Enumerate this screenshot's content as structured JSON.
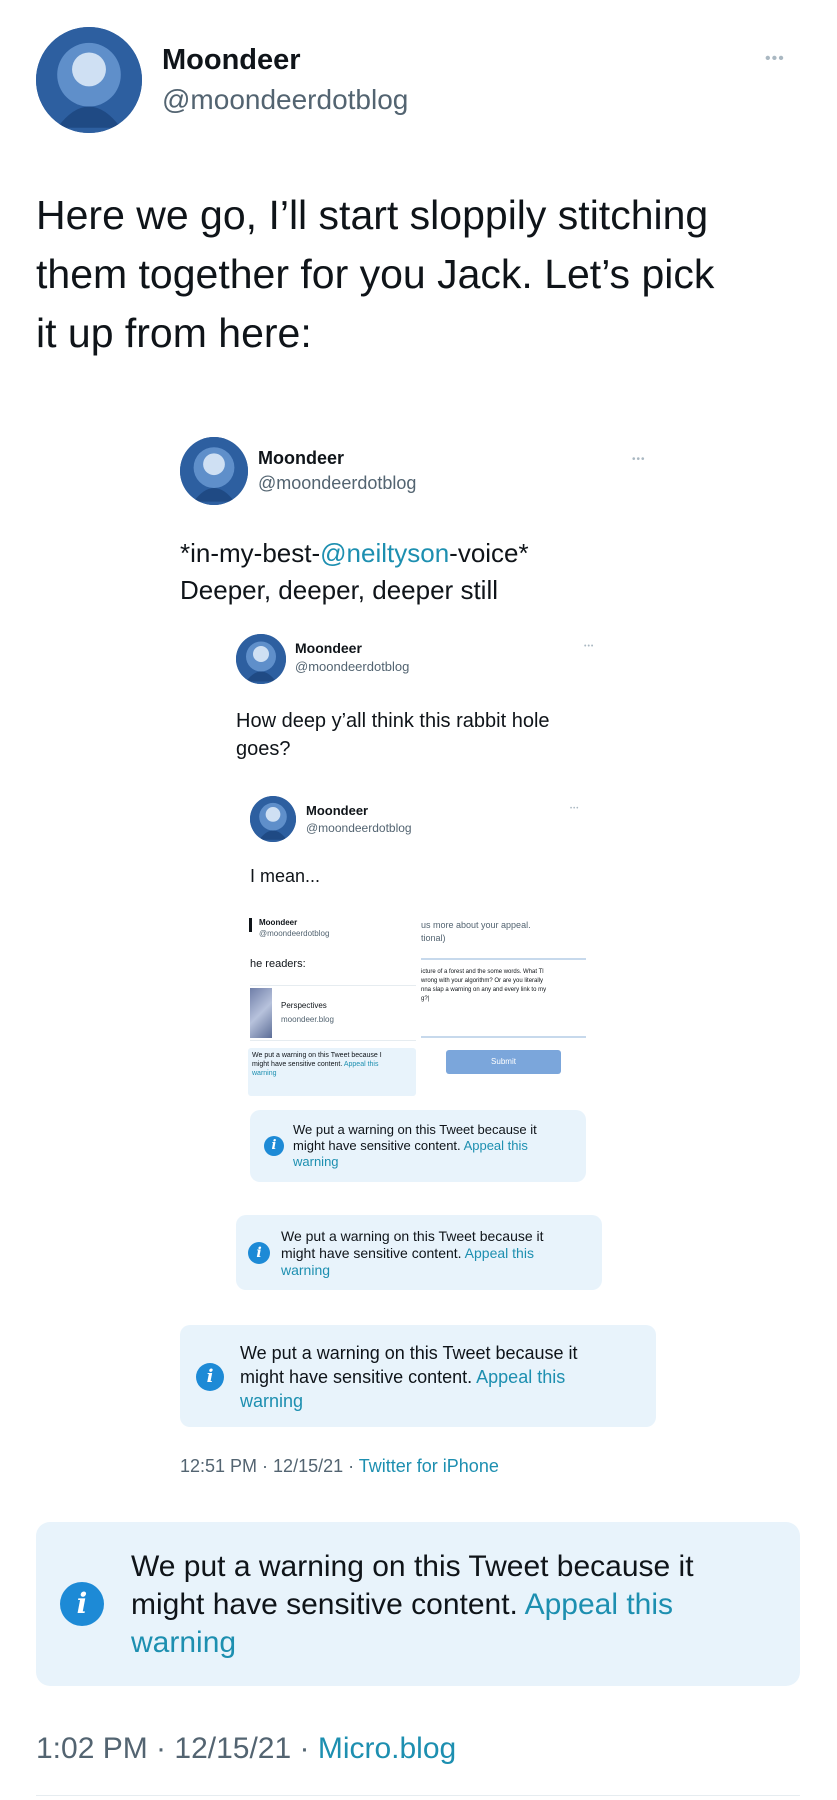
{
  "colors": {
    "accent": "#1d8fb0",
    "warning_bg": "#e8f3fb",
    "info_icon": "#1d8ad6"
  },
  "tweet": {
    "author_name": "Moondeer",
    "handle": "@moondeerdotblog",
    "more": "•••",
    "text_line1": "Here we go, I’ll start sloppily stitching",
    "text_line2": "them together for you Jack. Let’s pick",
    "text_line3": "it up from here:",
    "warning": {
      "line1": "We put a warning on this Tweet because it",
      "line2_text": "might have sensitive content.",
      "line2_link": "Appeal this",
      "line3_link": "warning"
    },
    "timestamp": "1:02 PM · 12/15/21 · ",
    "source": "Micro.blog"
  },
  "nested1": {
    "author_name": "Moondeer",
    "handle": "@moondeerdotblog",
    "more": "•••",
    "text_prefix": "*in-my-best-",
    "mention": "@neiltyson",
    "text_suffix": "-voice*",
    "text_line2": "Deeper, deeper, deeper still",
    "warning": {
      "line1": "We put a warning on this Tweet because it",
      "line2_text": "might have sensitive content.",
      "line2_link": "Appeal this",
      "line3_link": "warning"
    },
    "timestamp": "12:51 PM · 12/15/21 · ",
    "source": "Twitter for iPhone"
  },
  "nested2": {
    "author_name": "Moondeer",
    "handle": "@moondeerdotblog",
    "more": "•••",
    "text_line1": "How deep y’all think this rabbit hole",
    "text_line2": "goes?",
    "warning": {
      "line1": "We put a warning on this Tweet because it",
      "line2_text": "might have sensitive content.",
      "line2_link": "Appeal this",
      "line3_link": "warning"
    }
  },
  "nested3": {
    "author_name": "Moondeer",
    "handle": "@moondeerdotblog",
    "more": "•••",
    "text": "I mean...",
    "warning": {
      "line1": "We put a warning on this Tweet because it",
      "line2_text": "might have sensitive content.",
      "line2_link": "Appeal this",
      "line3_link": "warning"
    }
  },
  "nested4": {
    "author_name": "Moondeer",
    "handle": "@moondeerdotblog",
    "readers": "he readers:",
    "card_title": "Perspectives",
    "card_domain": "moondeer.blog",
    "warning_line1": "We put a warning on this Tweet because I",
    "warning_line2_text": "might have sensitive content.",
    "warning_line2_link": "Appeal this",
    "warning_line3_link": "warning",
    "appeal_line1": "us more about your appeal.",
    "appeal_line2": "tional)",
    "appeal_text1": "icture of a forest and the some words. What Tl",
    "appeal_text2": "wrong with your algorithm? Or are you literally",
    "appeal_text3": "nna slap a warning on any and every link to my",
    "appeal_text4": "g?|",
    "submit": "Submit"
  }
}
